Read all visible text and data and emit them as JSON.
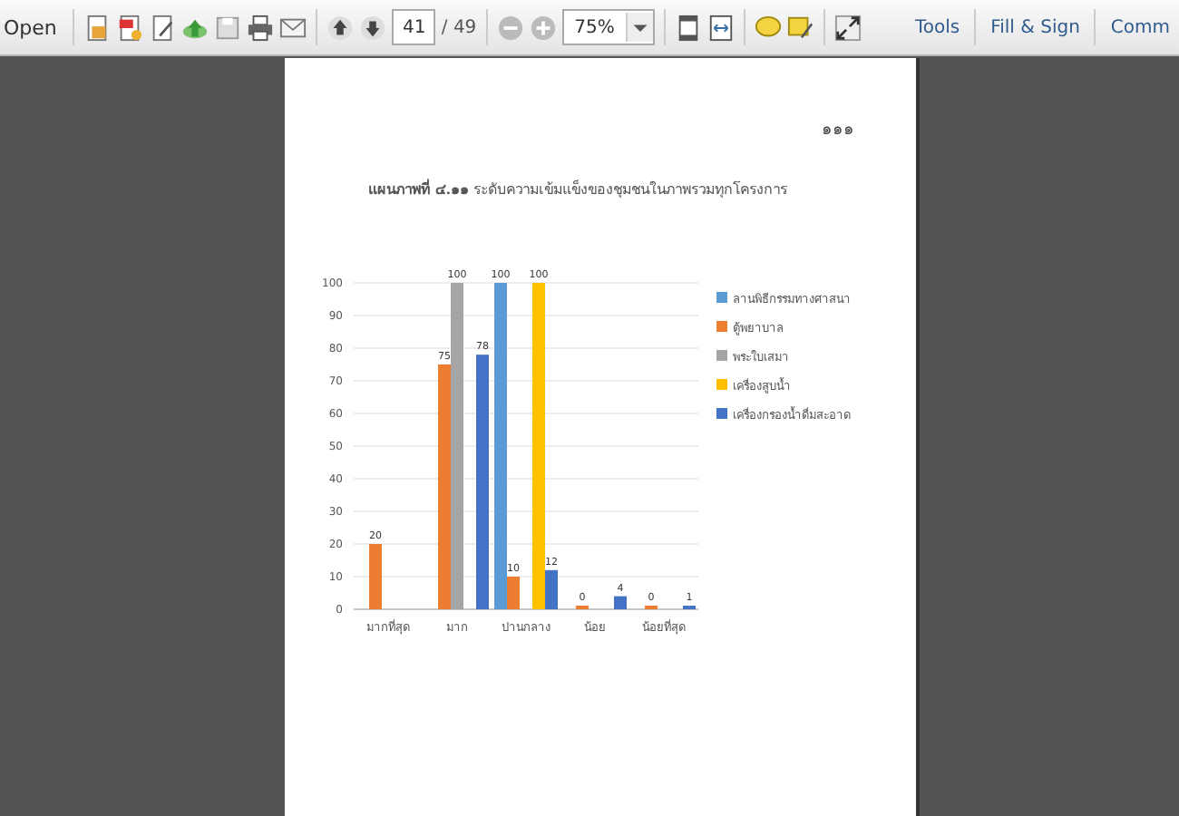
{
  "toolbar": {
    "open_label": "Open",
    "page": "41",
    "page_total": "/ 49",
    "zoom": "75%",
    "links": [
      "Tools",
      "Fill & Sign",
      "Comm"
    ]
  },
  "page": {
    "page_number": "๑๑๑",
    "caption": "**แผนภาพที่ ๔.๑๑** ระดับความเข้มแข็งของชุมชนในภาพรวมทุกโครงการ",
    "chart_data": {
      "type": "bar",
      "categories": [
        "มากที่สุด",
        "มาก",
        "ปานกลาง",
        "น้อย",
        "น้อยที่สุด"
      ],
      "ylim": [
        0,
        100
      ],
      "yticks": [
        0,
        10,
        20,
        30,
        40,
        50,
        60,
        70,
        80,
        90,
        100
      ],
      "data_labels": true,
      "grid": true,
      "legend": "right",
      "series": [
        {
          "name": "ลานพิธีกรรมทางศาสนา",
          "color": "#5b9bd5",
          "values": [
            null,
            null,
            100,
            null,
            null
          ]
        },
        {
          "name": "ตู้พยาบาล",
          "color": "#ed7d31",
          "values": [
            20,
            75,
            10,
            0,
            0
          ]
        },
        {
          "name": "พระใบเสมา",
          "color": "#a5a5a5",
          "values": [
            null,
            100,
            null,
            null,
            null
          ]
        },
        {
          "name": "เครื่องสูบน้ำ",
          "color": "#ffc000",
          "values": [
            null,
            null,
            100,
            null,
            null
          ]
        },
        {
          "name": "เครื่องกรองน้ำดื่มสะอาด",
          "color": "#4472c4",
          "values": [
            null,
            78,
            12,
            4,
            1
          ]
        }
      ]
    }
  }
}
